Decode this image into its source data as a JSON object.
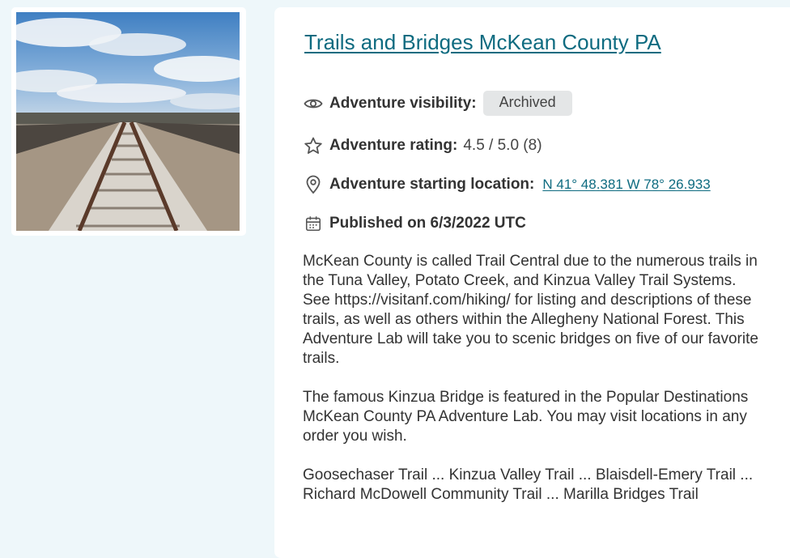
{
  "adventure": {
    "title": "Trails and Bridges McKean County PA",
    "visibility_label": "Adventure visibility:",
    "visibility_value": "Archived",
    "rating_label": "Adventure rating:",
    "rating_value": "4.5 / 5.0 (8)",
    "location_label": "Adventure starting location:",
    "location_value": "N 41° 48.381 W 78° 26.933",
    "published": "Published on 6/3/2022 UTC",
    "description": [
      "McKean County is called Trail Central due to the numerous trails in the Tuna Valley, Potato Creek, and Kinzua Valley Trail Systems. See https://visitanf.com/hiking/ for listing and descriptions of these trails, as well as others within the Allegheny National Forest. This Adventure Lab will take you to scenic bridges on five of our favorite trails.",
      "The famous Kinzua Bridge is featured in the Popular Destinations McKean County PA Adventure Lab. You may visit locations in any order you wish.",
      "Goosechaser Trail ... Kinzua Valley Trail ... Blaisdell-Emery Trail ... Richard McDowell Community Trail ... Marilla Bridges Trail"
    ]
  },
  "icons": {
    "visibility": "eye-icon",
    "rating": "star-icon",
    "location": "map-pin-icon",
    "published": "calendar-icon"
  },
  "colors": {
    "page_bg": "#eef7fa",
    "link": "#0e6b80",
    "badge_bg": "#e4e6e7"
  }
}
